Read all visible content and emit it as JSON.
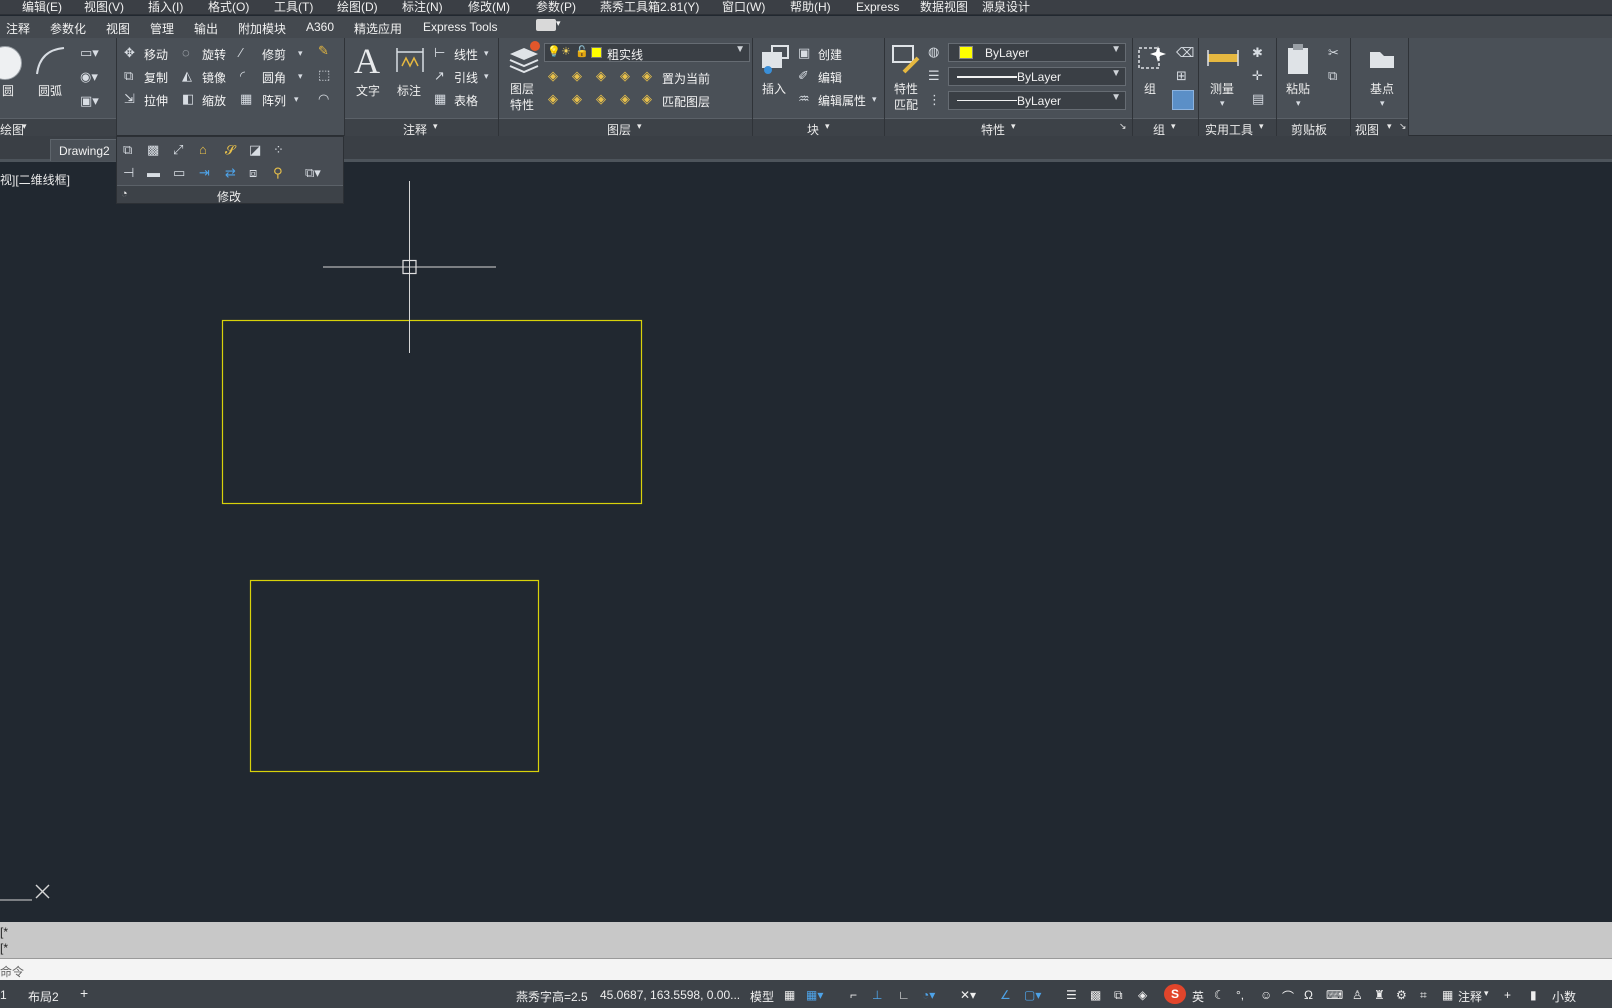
{
  "menubar": {
    "items": [
      "编辑(E)",
      "视图(V)",
      "插入(I)",
      "格式(O)",
      "工具(T)",
      "绘图(D)",
      "标注(N)",
      "修改(M)",
      "参数(P)",
      "燕秀工具箱2.81(Y)",
      "窗口(W)",
      "帮助(H)",
      "Express",
      "数据视图",
      "源泉设计"
    ]
  },
  "ribbon_tabs": [
    "注释",
    "参数化",
    "视图",
    "管理",
    "输出",
    "附加模块",
    "A360",
    "精选应用",
    "Express Tools"
  ],
  "draw_panel": {
    "circle": "圆",
    "arc": "圆弧",
    "panel_title": "绘图"
  },
  "modify_panel": {
    "move": "移动",
    "rotate": "旋转",
    "trim": "修剪",
    "copy": "复制",
    "mirror": "镜像",
    "fillet": "圆角",
    "stretch": "拉伸",
    "scale": "缩放",
    "array": "阵列",
    "panel_title": "修改"
  },
  "annotation_panel": {
    "text": "文字",
    "dimension": "标注",
    "linear": "线性",
    "leader": "引线",
    "table": "表格",
    "panel_title": "注释"
  },
  "layers_panel": {
    "layer_properties_1": "图层",
    "layer_properties_2": "特性",
    "current_layer": "粗实线",
    "make_current": "置为当前",
    "match_layer": "匹配图层",
    "panel_title": "图层"
  },
  "block_panel": {
    "insert": "插入",
    "create": "创建",
    "edit": "编辑",
    "edit_attributes": "编辑属性",
    "panel_title": "块"
  },
  "properties_panel": {
    "match_1": "特性",
    "match_2": "匹配",
    "color": "ByLayer",
    "lineweight": "ByLayer",
    "linetype": "ByLayer",
    "panel_title": "特性"
  },
  "groups_panel": {
    "group": "组",
    "panel_title": "组"
  },
  "utilities_panel": {
    "measure": "测量",
    "panel_title": "实用工具"
  },
  "clipboard_panel": {
    "paste": "粘贴",
    "panel_title": "剪贴板"
  },
  "view_panel": {
    "base_point": "基点",
    "panel_title": "视图"
  },
  "doc_tabs": {
    "drawing": "Drawing2"
  },
  "viewport": {
    "label": "视][二维线框]"
  },
  "command": {
    "history_1": "[*",
    "history_2": "[*",
    "prompt": "命令"
  },
  "layout_tabs": {
    "tab1": "1",
    "tab2": "布局2",
    "add": "+"
  },
  "statusbar": {
    "text_height": "燕秀字高=2.5",
    "coordinates": "45.0687, 163.5598, 0.00...",
    "model": "模型",
    "annotation": "注释",
    "units": "小数",
    "ime": "英"
  },
  "colors": {
    "rect_yellow": "#d8d20a",
    "canvas_bg": "#212830",
    "ribbon_bg": "#4a5057",
    "layer_yellow": "#ffff00"
  }
}
